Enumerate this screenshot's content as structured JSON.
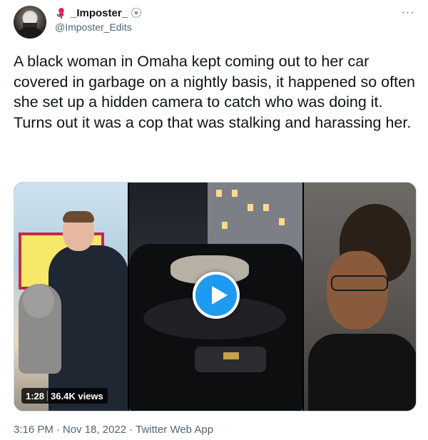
{
  "author": {
    "display_name": "_Imposter_",
    "handle": "@Imposter_Edits",
    "avatar_icon": "profile-photo",
    "name_prefix_icon": "rose-icon",
    "name_suffix_icon": "verified-style-badge-icon"
  },
  "menu": {
    "more_icon": "more-horizontal-icon",
    "more_glyph": "···"
  },
  "tweet": {
    "text_line_1": "A black woman in Omaha kept coming out to her car covered in garbage on a nightly basis, it happened so often she set up a hidden camera to catch who was doing it.",
    "text_line_2": "Turns out it was a cop that was stalking and harassing her."
  },
  "media": {
    "duration": "1:28",
    "views": "36.4K views",
    "play_icon": "play-icon"
  },
  "meta": {
    "time": "3:16 PM",
    "dot1": "·",
    "date": "Nov 18, 2022",
    "dot2": "·",
    "source": "Twitter Web App"
  },
  "colors": {
    "accent": "#1d9bf0",
    "text_primary": "#0f1419",
    "text_secondary": "#536471",
    "border": "#cfd9de"
  }
}
